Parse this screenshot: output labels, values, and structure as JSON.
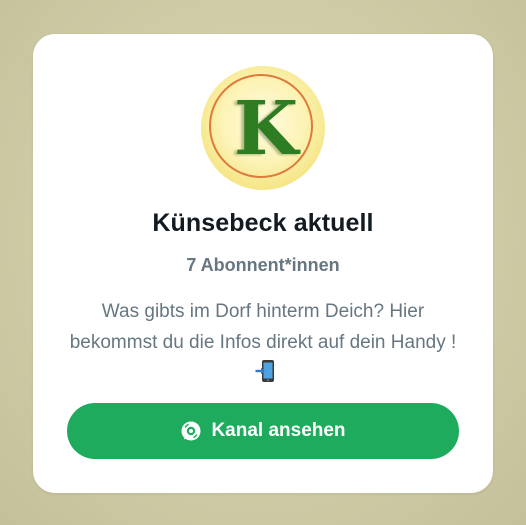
{
  "channel": {
    "avatar_letter": "K",
    "name": "Künsebeck aktuell",
    "followers": "7 Abonnent*innen",
    "description": "Was gibts im Dorf hinterm Deich? Hier bekommst du die Infos direkt auf dein Handy !",
    "description_emoji_icon": "mobile-phone-arrow-icon"
  },
  "actions": {
    "view_channel_label": "Kanal ansehen",
    "view_channel_icon": "channel-icon"
  },
  "colors": {
    "accent_green": "#1fab5e",
    "title_text": "#111b21",
    "secondary_text": "#667781",
    "avatar_letter": "#2f7d22"
  }
}
